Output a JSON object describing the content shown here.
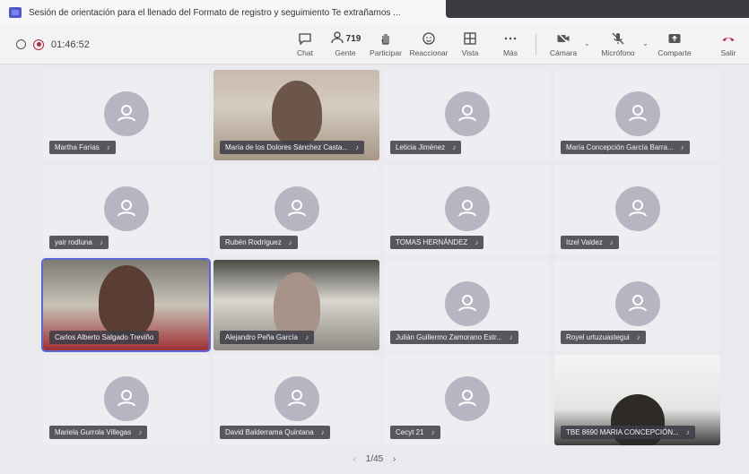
{
  "window": {
    "title": "Sesión de orientación para el llenado del Formato de registro y seguimiento Te extrañamos ..."
  },
  "toolbar": {
    "timer": "01:46:52",
    "buttons": [
      {
        "label": "Chat",
        "icon": "chat-icon"
      },
      {
        "label": "Gente",
        "icon": "people-icon",
        "count": "719"
      },
      {
        "label": "Participar",
        "icon": "raise-hand-icon"
      },
      {
        "label": "Reaccionar",
        "icon": "smiley-icon"
      },
      {
        "label": "Vista",
        "icon": "grid-icon"
      },
      {
        "label": "Más",
        "icon": "more-icon"
      },
      {
        "label": "Cámara",
        "icon": "camera-off-icon"
      },
      {
        "label": "Micrófono",
        "icon": "mic-off-icon"
      },
      {
        "label": "Comparte",
        "icon": "share-icon"
      },
      {
        "label": "Salir",
        "icon": "leave-call-icon"
      }
    ]
  },
  "participants": [
    {
      "name": "Martha Farías"
    },
    {
      "name": "María de los Dolores Sánchez Casta..."
    },
    {
      "name": "Leticia Jiménez"
    },
    {
      "name": "María Concepción García Barra..."
    },
    {
      "name": "yair rodluna"
    },
    {
      "name": "Rubén Rodríguez"
    },
    {
      "name": "TOMAS HERNÁNDEZ"
    },
    {
      "name": "Itzel Valdez"
    },
    {
      "name": "Carlos Alberto Salgado Treviño"
    },
    {
      "name": "Alejandro Peña García"
    },
    {
      "name": "Julián Guillermo Zamorano Estr..."
    },
    {
      "name": "Royel urtuzuastegui"
    },
    {
      "name": "Mariela Gurrola Villegas"
    },
    {
      "name": "David Balderrama Quintana"
    },
    {
      "name": "Cecyt 21"
    },
    {
      "name": "TBE 8690 MARIA CONCEPCIÓN..."
    }
  ],
  "pager": {
    "label": "1/45"
  },
  "colors": {
    "accent": "#5b67d8",
    "record": "#b0283a",
    "leave": "#c4314b"
  }
}
